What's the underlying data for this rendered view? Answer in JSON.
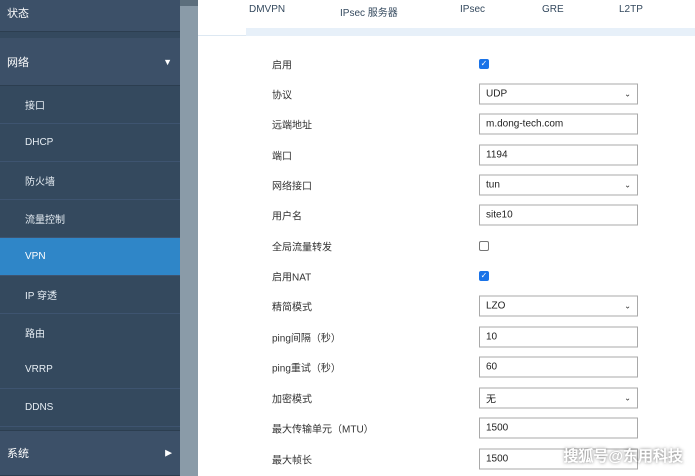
{
  "sidebar": {
    "status": "状态",
    "network": "网络",
    "items": [
      "接口",
      "DHCP",
      "防火墙",
      "流量控制",
      "VPN",
      "IP 穿透",
      "路由",
      "VRRP",
      "DDNS"
    ],
    "system": "系统"
  },
  "tabs": [
    "DMVPN",
    "IPsec 服务器",
    "IPsec",
    "GRE",
    "L2TP"
  ],
  "form": {
    "enable": {
      "label": "启用",
      "checked": true
    },
    "protocol": {
      "label": "协议",
      "value": "UDP"
    },
    "remote": {
      "label": "远端地址",
      "value": "m.dong-tech.com"
    },
    "port": {
      "label": "端口",
      "value": "1194"
    },
    "iface": {
      "label": "网络接口",
      "value": "tun"
    },
    "username": {
      "label": "用户名",
      "value": "site10"
    },
    "global_forward": {
      "label": "全局流量转发",
      "checked": false
    },
    "nat": {
      "label": "启用NAT",
      "checked": true
    },
    "compress": {
      "label": "精简模式",
      "value": "LZO"
    },
    "ping_interval": {
      "label": "ping间隔（秒）",
      "value": "10"
    },
    "ping_retry": {
      "label": "ping重试（秒）",
      "value": "60"
    },
    "encryption": {
      "label": "加密模式",
      "value": "无"
    },
    "mtu": {
      "label": "最大传输单元（MTU）",
      "value": "1500"
    },
    "max_frame": {
      "label": "最大帧长",
      "value": "1500"
    }
  },
  "watermark": "搜狐号@东用科技",
  "colors": {
    "sidebar": "#34495e",
    "active": "#2f86c8",
    "checkbox": "#1a73e8"
  }
}
